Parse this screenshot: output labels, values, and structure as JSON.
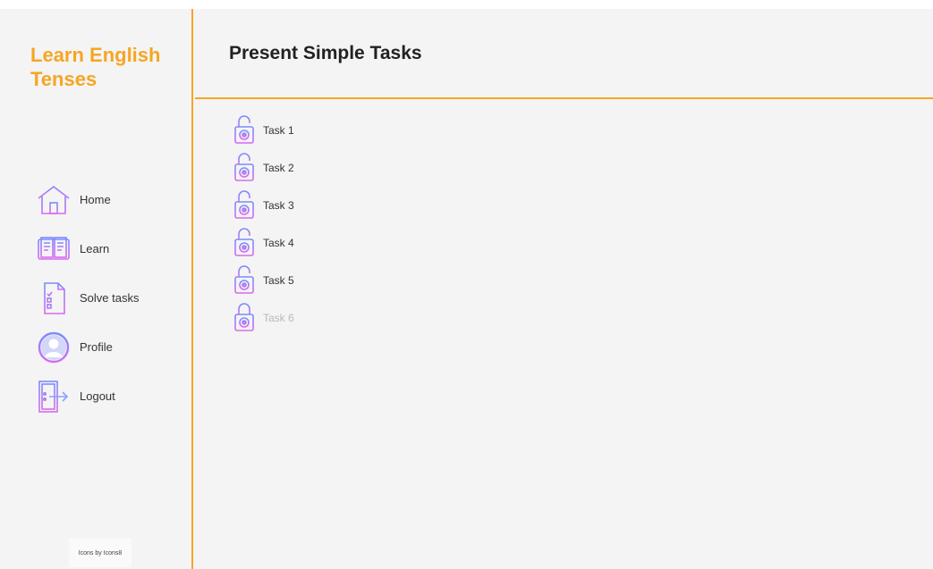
{
  "sidebar": {
    "brand": "Learn English Tenses",
    "items": [
      {
        "label": "Home",
        "icon": "home-icon"
      },
      {
        "label": "Learn",
        "icon": "book-icon"
      },
      {
        "label": "Solve tasks",
        "icon": "checklist-icon"
      },
      {
        "label": "Profile",
        "icon": "user-icon"
      },
      {
        "label": "Logout",
        "icon": "logout-icon"
      }
    ],
    "credit": "Icons by Icons8"
  },
  "header": {
    "title": "Present Simple Tasks"
  },
  "tasks": [
    {
      "label": "Task 1",
      "status": "unlocked",
      "icon": "unlocked-padlock-icon"
    },
    {
      "label": "Task 2",
      "status": "unlocked",
      "icon": "unlocked-padlock-icon"
    },
    {
      "label": "Task 3",
      "status": "unlocked",
      "icon": "unlocked-padlock-icon"
    },
    {
      "label": "Task 4",
      "status": "unlocked",
      "icon": "unlocked-padlock-icon"
    },
    {
      "label": "Task 5",
      "status": "unlocked",
      "icon": "unlocked-padlock-icon"
    },
    {
      "label": "Task 6",
      "status": "locked",
      "icon": "locked-padlock-icon"
    }
  ],
  "colors": {
    "accent": "#f5a623",
    "icon_gradient_start": "#7b8cff",
    "icon_gradient_end": "#d66bf0",
    "disabled_text": "#b9b9b9"
  }
}
